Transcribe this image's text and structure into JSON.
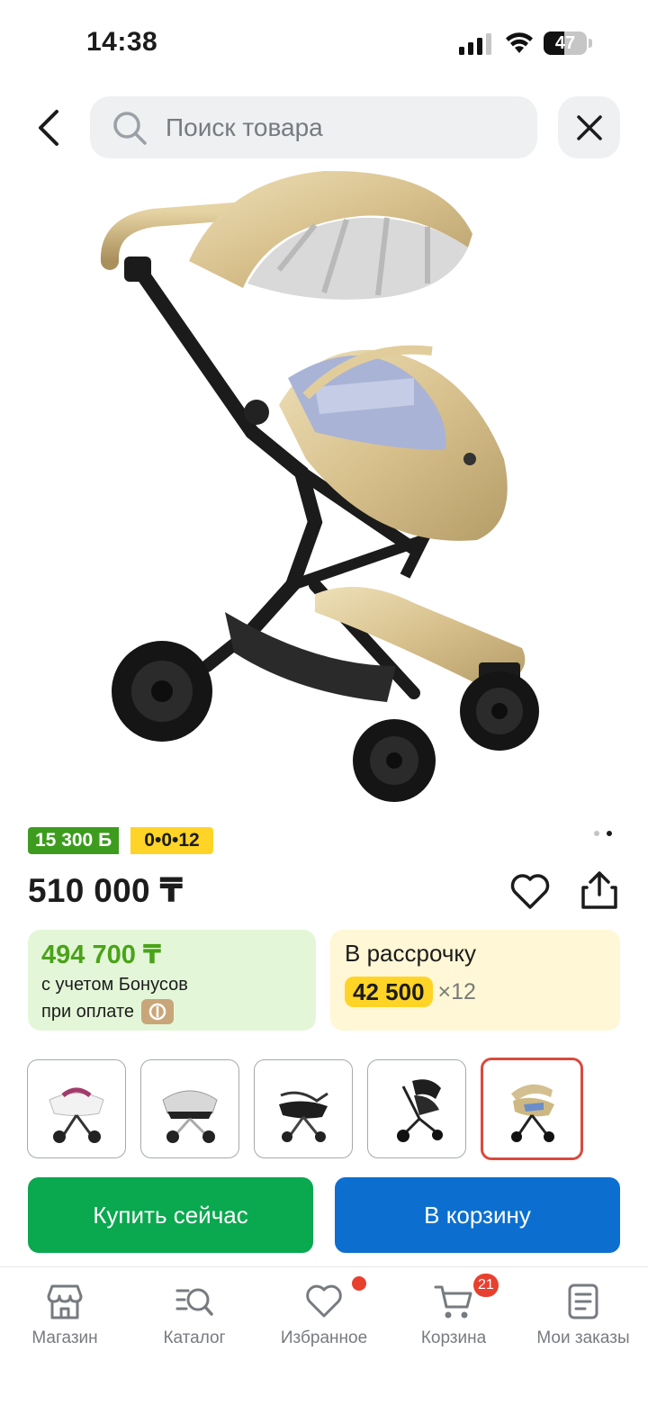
{
  "status_bar": {
    "time": "14:38",
    "battery": "47",
    "battery_level": 0.47
  },
  "search": {
    "placeholder": "Поиск товара"
  },
  "product": {
    "bonus_badge": "15 300 Б",
    "installment_badge": "0•0•12",
    "price": "510 000 ₸",
    "gallery": {
      "total_pages": 2,
      "current_page": 2
    }
  },
  "bonus_card": {
    "price": "494 700 ₸",
    "line1": "с учетом Бонусов",
    "line2": "при оплате"
  },
  "installment_card": {
    "title": "В рассрочку",
    "amount": "42 500",
    "months": "×12"
  },
  "thumbnails": [
    {
      "name": "thumb-white-pink",
      "selected": false
    },
    {
      "name": "thumb-silver",
      "selected": false
    },
    {
      "name": "thumb-black-carrycot",
      "selected": false
    },
    {
      "name": "thumb-black-seat",
      "selected": false
    },
    {
      "name": "thumb-champagne",
      "selected": true
    }
  ],
  "actions": {
    "buy_label": "Купить сейчас",
    "cart_label": "В корзину"
  },
  "bottom_nav": {
    "items": [
      {
        "label": "Магазин",
        "icon": "store-icon"
      },
      {
        "label": "Каталог",
        "icon": "catalog-search-icon"
      },
      {
        "label": "Избранное",
        "icon": "heart-icon"
      },
      {
        "label": "Корзина",
        "icon": "cart-icon",
        "badge": "21"
      },
      {
        "label": "Мои заказы",
        "icon": "orders-icon"
      }
    ]
  },
  "colors": {
    "buy": "#0aa84f",
    "cart": "#0c6fd0",
    "bonus_green": "#3d9c1e",
    "installment_yellow": "#ffd426",
    "badge_red": "#e8402f"
  }
}
